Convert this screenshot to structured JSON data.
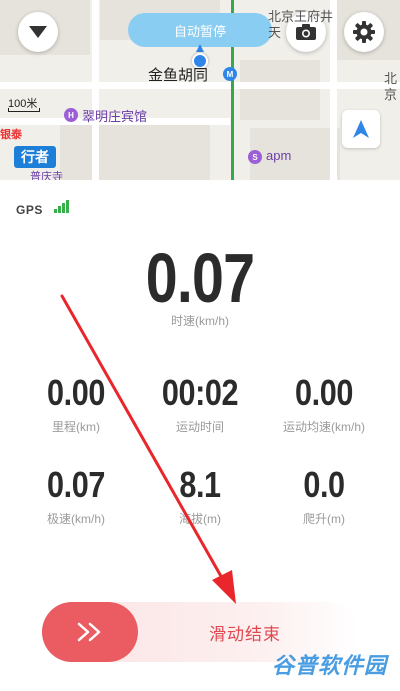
{
  "map": {
    "pause_label": "自动暂停",
    "labels": {
      "hutong": "金鱼胡同",
      "hotel": "翠明庄宾馆",
      "apm": "apm",
      "north_top": "北京王府井",
      "tian": "天",
      "north_side": "北",
      "jing": "京",
      "putong": "普庆寺"
    },
    "scale": "100米",
    "walker_badge": "行者",
    "red_logo": "银泰"
  },
  "gps": {
    "label": "GPS"
  },
  "speed": {
    "value": "0.07",
    "label": "时速(km/h)"
  },
  "stats": [
    {
      "value": "0.00",
      "label": "里程(km)"
    },
    {
      "value": "00:02",
      "label": "运动时间"
    },
    {
      "value": "0.00",
      "label": "运动均速(km/h)"
    },
    {
      "value": "0.07",
      "label": "极速(km/h)"
    },
    {
      "value": "8.1",
      "label": "海拔(m)"
    },
    {
      "value": "0.0",
      "label": "爬升(m)"
    }
  ],
  "slider": {
    "label": "滑动结束",
    "knob_glyph": "»"
  },
  "watermark": "谷普软件园",
  "icons": {
    "dropdown": "chevron-down-icon",
    "camera": "camera-icon",
    "settings": "gear-icon",
    "compass": "navigation-arrow-icon",
    "location": "location-dot-icon"
  },
  "colors": {
    "accent_red": "#ea5b62",
    "pause_blue": "#89cdf2",
    "signal_green": "#36b14a",
    "annotation_red": "#e8262b"
  }
}
